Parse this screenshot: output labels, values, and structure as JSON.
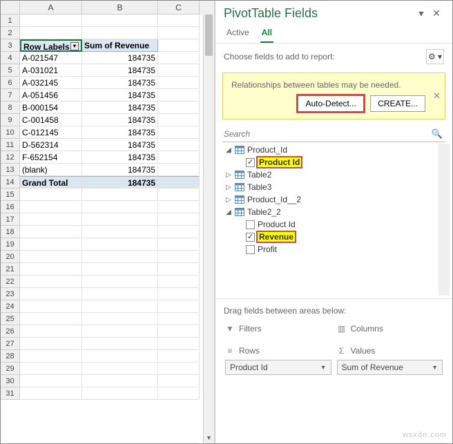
{
  "sheet": {
    "cols": [
      "A",
      "B",
      "C"
    ],
    "header": {
      "rowlabels": "Row Labels",
      "sumrev": "Sum of Revenue"
    },
    "rows": [
      {
        "n": 1,
        "a": "",
        "b": ""
      },
      {
        "n": 2,
        "a": "",
        "b": ""
      },
      {
        "n": 3,
        "a": "Row Labels",
        "b": "Sum of Revenue",
        "hdr": true
      },
      {
        "n": 4,
        "a": "A-021547",
        "b": "184735"
      },
      {
        "n": 5,
        "a": "A-031021",
        "b": "184735"
      },
      {
        "n": 6,
        "a": "A-032145",
        "b": "184735"
      },
      {
        "n": 7,
        "a": "A-051456",
        "b": "184735"
      },
      {
        "n": 8,
        "a": "B-000154",
        "b": "184735"
      },
      {
        "n": 9,
        "a": "C-001458",
        "b": "184735"
      },
      {
        "n": 10,
        "a": "C-012145",
        "b": "184735"
      },
      {
        "n": 11,
        "a": "D-562314",
        "b": "184735"
      },
      {
        "n": 12,
        "a": "F-652154",
        "b": "184735"
      },
      {
        "n": 13,
        "a": "(blank)",
        "b": "184735"
      },
      {
        "n": 14,
        "a": "Grand Total",
        "b": "184735",
        "gt": true
      },
      {
        "n": 15,
        "a": "",
        "b": ""
      },
      {
        "n": 16,
        "a": "",
        "b": ""
      },
      {
        "n": 17,
        "a": "",
        "b": ""
      },
      {
        "n": 18,
        "a": "",
        "b": ""
      },
      {
        "n": 19,
        "a": "",
        "b": ""
      },
      {
        "n": 20,
        "a": "",
        "b": ""
      },
      {
        "n": 21,
        "a": "",
        "b": ""
      },
      {
        "n": 22,
        "a": "",
        "b": ""
      },
      {
        "n": 23,
        "a": "",
        "b": ""
      },
      {
        "n": 24,
        "a": "",
        "b": ""
      },
      {
        "n": 25,
        "a": "",
        "b": ""
      },
      {
        "n": 26,
        "a": "",
        "b": ""
      },
      {
        "n": 27,
        "a": "",
        "b": ""
      },
      {
        "n": 28,
        "a": "",
        "b": ""
      },
      {
        "n": 29,
        "a": "",
        "b": ""
      },
      {
        "n": 30,
        "a": "",
        "b": ""
      },
      {
        "n": 31,
        "a": "",
        "b": ""
      }
    ]
  },
  "pane": {
    "title": "PivotTable Fields",
    "tabs": {
      "active": "Active",
      "all": "All"
    },
    "choose": "Choose fields to add to report:",
    "warn": {
      "msg": "Relationships between tables may be needed.",
      "auto": "Auto-Detect...",
      "create": "CREATE..."
    },
    "search": {
      "placeholder": "Search"
    },
    "tables": [
      {
        "name": "Product_Id",
        "open": true,
        "fields": [
          {
            "name": "Product Id",
            "checked": true,
            "hl": true
          }
        ]
      },
      {
        "name": "Table2",
        "open": false
      },
      {
        "name": "Table3",
        "open": false
      },
      {
        "name": "Product_Id__2",
        "open": false
      },
      {
        "name": "Table2_2",
        "open": true,
        "fields": [
          {
            "name": "Product Id",
            "checked": false
          },
          {
            "name": "Revenue",
            "checked": true,
            "hl": true
          },
          {
            "name": "Profit",
            "checked": false
          }
        ]
      }
    ],
    "drag": "Drag fields between areas below:",
    "areas": {
      "filters": {
        "label": "Filters"
      },
      "columns": {
        "label": "Columns"
      },
      "rows": {
        "label": "Rows",
        "item": "Product Id"
      },
      "values": {
        "label": "Values",
        "item": "Sum of Revenue"
      }
    }
  },
  "watermark": "wsxdn.com"
}
